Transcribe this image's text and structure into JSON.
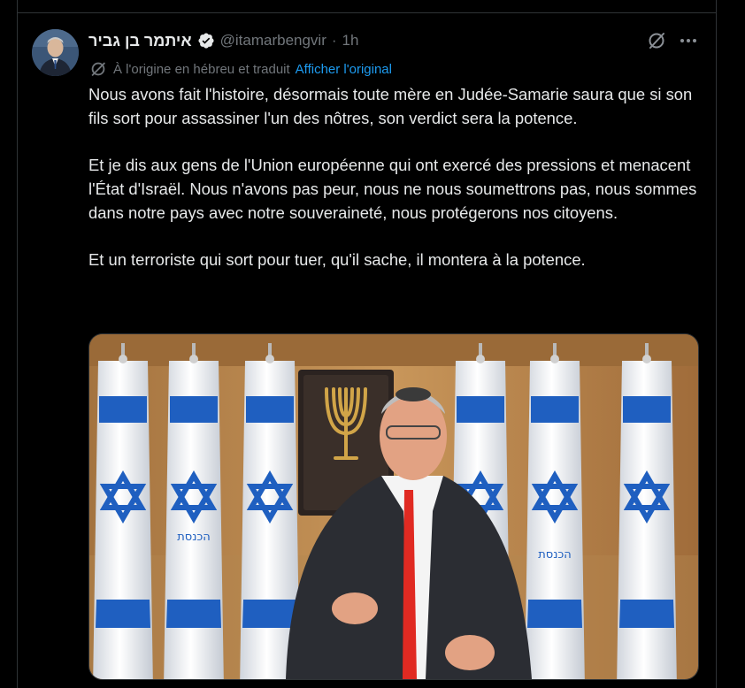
{
  "tweet": {
    "author": {
      "display_name": "איתמר בן גביר",
      "handle": "@itamarbengvir",
      "separator": "·",
      "time": "1h",
      "verified": true
    },
    "translation": {
      "label": "À l'origine en hébreu et traduit",
      "link": "Afficher l'original"
    },
    "paragraphs": [
      "Nous avons fait l'histoire, désormais toute mère en Judée-Samarie saura que si son fils sort pour assassiner l'un des nôtres, son verdict sera la potence.",
      "Et je dis aux gens de l'Union européenne qui ont exercé des pressions et menacent l'État d'Israël. Nous n'avons pas peur, nous ne nous soumettrons pas, nous sommes dans notre pays avec notre souveraineté, nous protégerons nos citoyens.",
      "Et un terroriste qui sort pour tuer, qu'il sache, il montera à la potence."
    ],
    "media": {
      "kind": "video-still",
      "flag_emblem_text": "הכנסת"
    }
  },
  "icons": {
    "verified": "verified-badge-icon",
    "grok": "grok-icon",
    "more": "more-icon",
    "translate": "translate-icon"
  },
  "colors": {
    "background": "#000000",
    "text": "#e7e9ea",
    "muted": "#71767b",
    "link": "#1d9bf0",
    "border": "#2f3336",
    "flag_blue": "#1f5fc0",
    "tie": "#e02a22"
  }
}
